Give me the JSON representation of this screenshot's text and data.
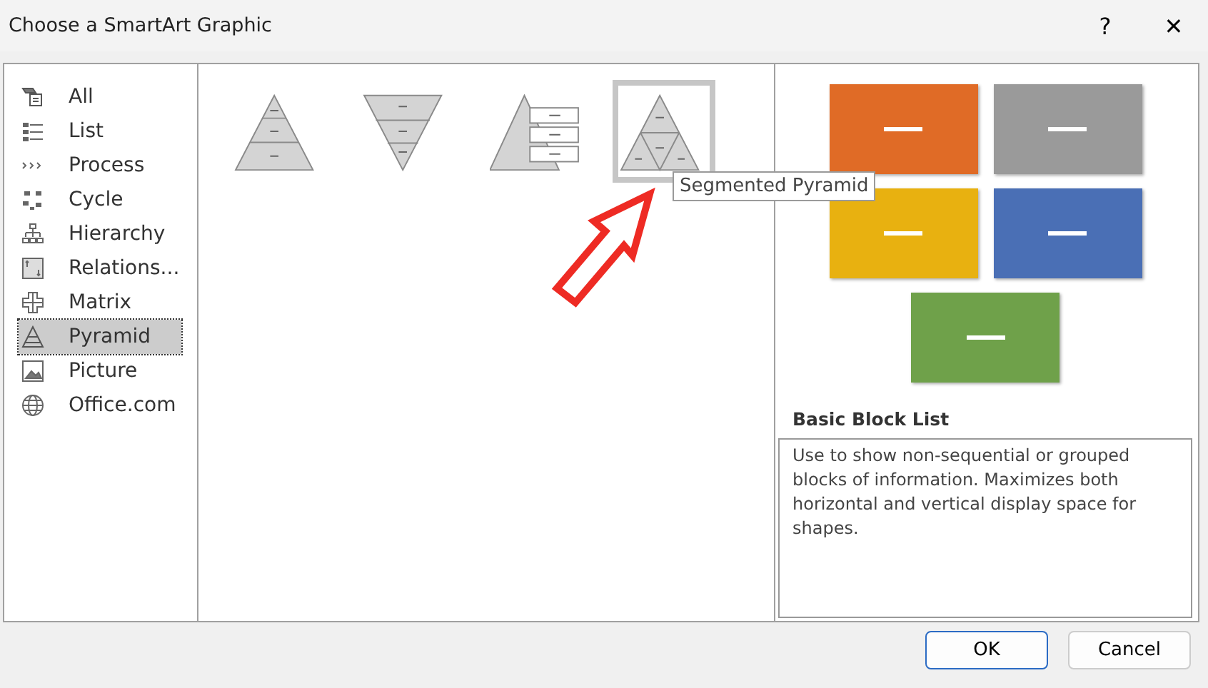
{
  "window": {
    "title": "Choose a SmartArt Graphic",
    "help": "?",
    "close": "✕"
  },
  "categories": [
    {
      "label": "All",
      "kind": "all",
      "selected": false
    },
    {
      "label": "List",
      "kind": "list",
      "selected": false
    },
    {
      "label": "Process",
      "kind": "process",
      "selected": false
    },
    {
      "label": "Cycle",
      "kind": "cycle",
      "selected": false
    },
    {
      "label": "Hierarchy",
      "kind": "hierarchy",
      "selected": false
    },
    {
      "label": "Relations...",
      "kind": "relations",
      "selected": false
    },
    {
      "label": "Matrix",
      "kind": "matrix",
      "selected": false
    },
    {
      "label": "Pyramid",
      "kind": "pyramid",
      "selected": true
    },
    {
      "label": "Picture",
      "kind": "picture",
      "selected": false
    },
    {
      "label": "Office.com",
      "kind": "web",
      "selected": false
    }
  ],
  "layouts": [
    {
      "kind": "basic",
      "selected": false
    },
    {
      "kind": "inverted",
      "selected": false
    },
    {
      "kind": "list",
      "selected": false
    },
    {
      "kind": "segmented",
      "selected": true,
      "tooltip": "Segmented Pyramid"
    }
  ],
  "preview": {
    "blocks": [
      {
        "color": "#e06b26"
      },
      {
        "color": "#9a9a9a"
      },
      {
        "color": "#e8b110"
      },
      {
        "color": "#4a6fb5"
      },
      {
        "color": "#6fa14a"
      }
    ],
    "title": "Basic Block List",
    "description": "Use to show non-sequential or grouped blocks of information. Maximizes both horizontal and vertical display space for shapes."
  },
  "buttons": [
    "OK",
    "Cancel"
  ]
}
